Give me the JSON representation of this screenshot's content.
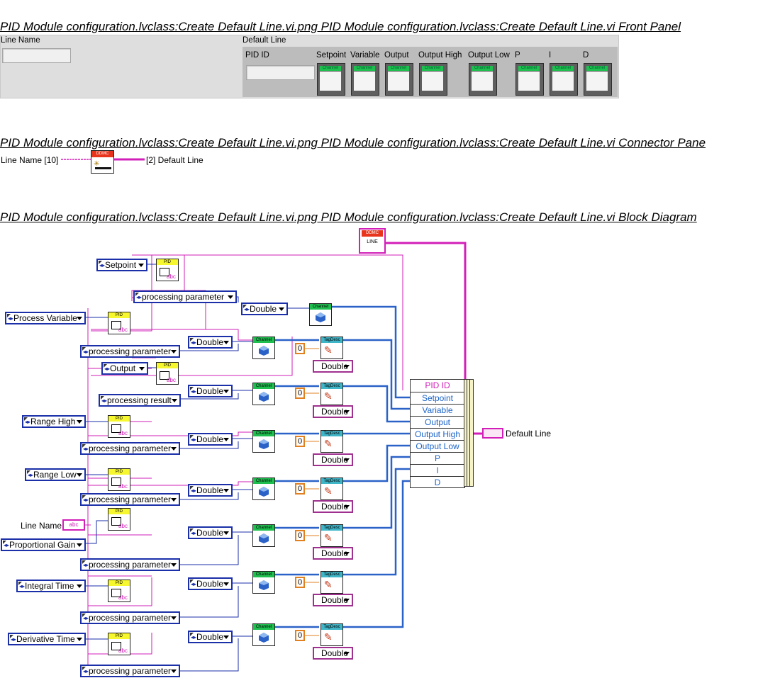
{
  "sections": {
    "front_panel_title": "PID Module configuration.lvclass:Create Default Line.vi.png  PID Module configuration.lvclass:Create Default Line.vi Front Panel",
    "connector_title": "PID Module configuration.lvclass:Create Default Line.vi.png  PID Module configuration.lvclass:Create Default Line.vi Connector Pane",
    "diagram_title": "PID Module configuration.lvclass:Create Default Line.vi.png  PID Module configuration.lvclass:Create Default Line.vi Block Diagram"
  },
  "front_panel": {
    "line_name_label": "Line Name",
    "default_line_label": "Default Line",
    "pid_id_label": "PID ID",
    "channel_labels": [
      "Setpoint",
      "Variable",
      "Output",
      "Output High",
      "Output Low",
      "P",
      "I",
      "D"
    ],
    "channel_tag": "Channel"
  },
  "connector": {
    "input_label": "Line Name [10]",
    "output_label": "[2] Default Line",
    "icon_text": "DDMC"
  },
  "diagram": {
    "ddmc_icon_top": "DDMC",
    "ddmc_icon_bottom": "LINE",
    "pid_tag": "PID",
    "abc_tag": "abc",
    "channel_tag": "Channel",
    "tagdesc_tag": "TagDesc",
    "zero": "0",
    "double_label": "Double",
    "line_name_label": "Line Name",
    "line_name_const": "abc",
    "default_line_indicator": "Default Line",
    "bundle_rows": [
      "PID ID",
      "Setpoint",
      "Variable",
      "Output",
      "Output High",
      "Output Low",
      "P",
      "I",
      "D"
    ],
    "controls": [
      {
        "name": "Setpoint",
        "param": "processing parameter"
      },
      {
        "name": "Process Variable",
        "param": "processing parameter"
      },
      {
        "name": "Output",
        "param": "processing result"
      },
      {
        "name": "Range High",
        "param": "processing parameter"
      },
      {
        "name": "Range Low",
        "param": "processing parameter"
      },
      {
        "name": "Proportional Gain",
        "param": "processing parameter"
      },
      {
        "name": "Integral Time",
        "param": "processing parameter"
      },
      {
        "name": "Derivative Time",
        "param": "processing parameter"
      }
    ]
  },
  "colors": {
    "control_border": "#1b2fa8",
    "pink_wire": "#d21fb8",
    "blue_wire": "#2a62c8",
    "pid_yellow": "#f7f730",
    "channel_green": "#1fbf4f",
    "tagdesc_teal": "#3fb5c8",
    "ddmc_red": "#e8341c"
  }
}
